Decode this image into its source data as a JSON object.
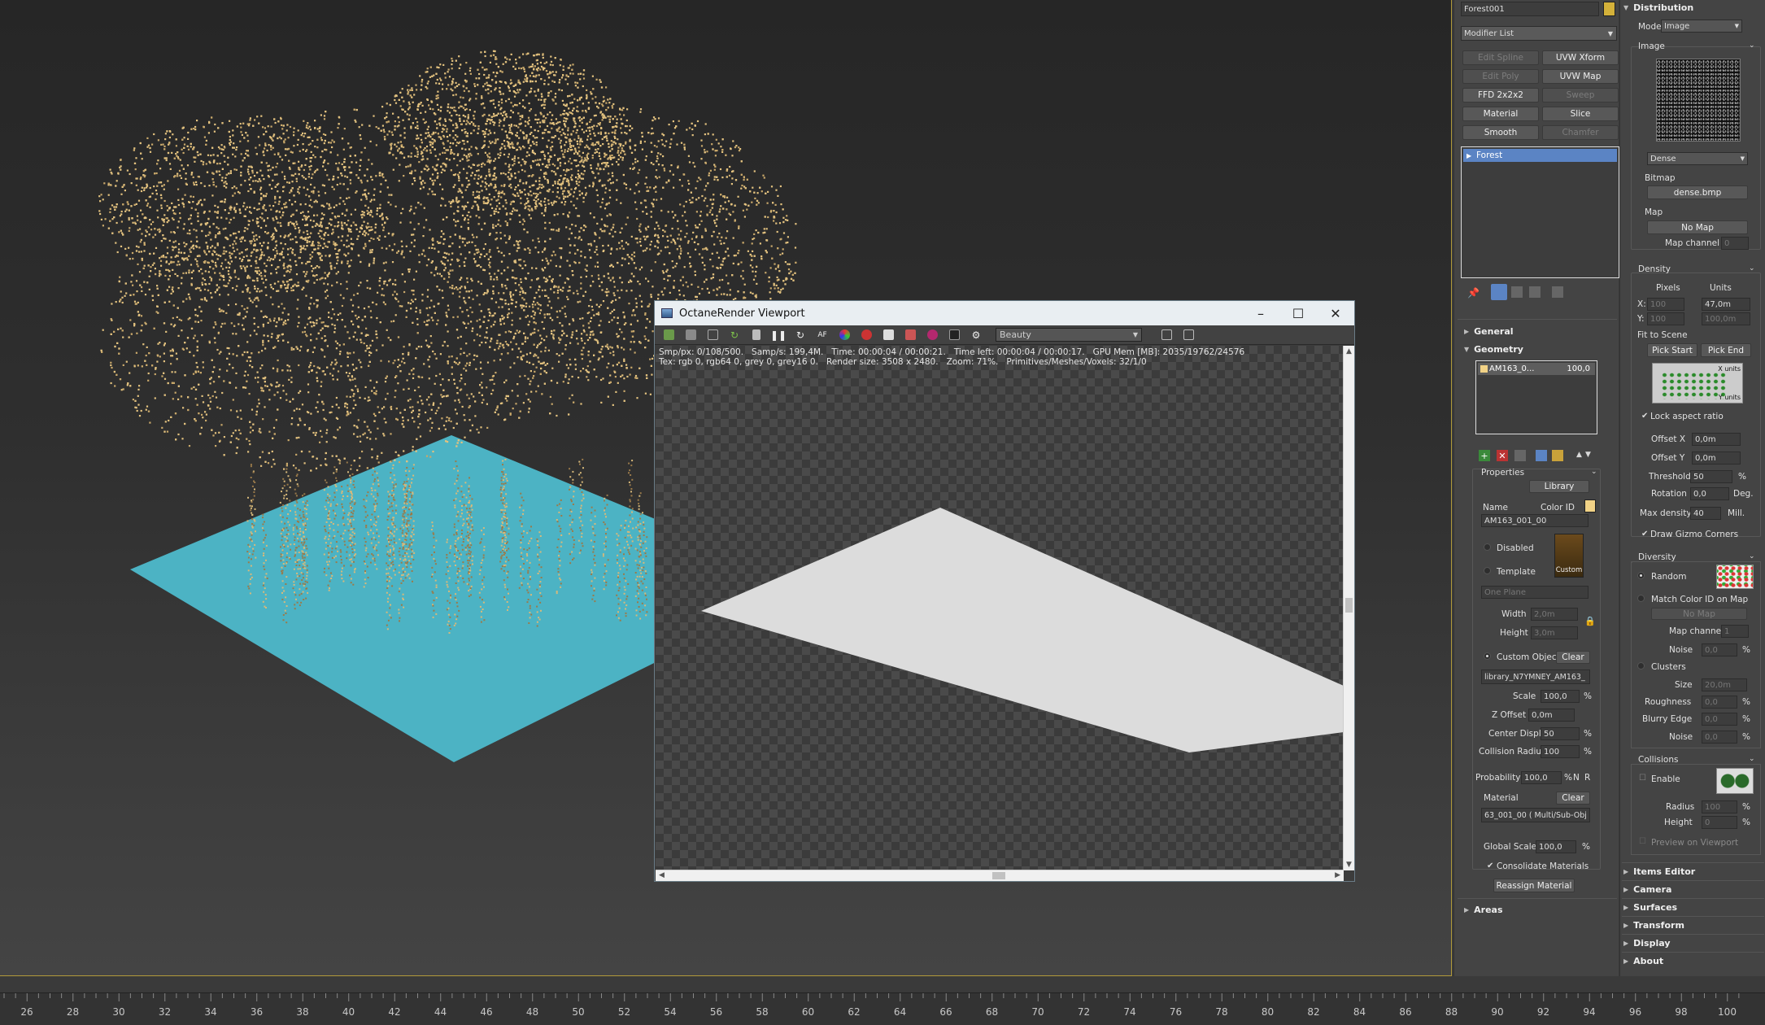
{
  "octane": {
    "title": "OctaneRender Viewport",
    "render_pass": "Beauty",
    "stats_line1": "Smp/px: 0/108/500.   Samp/s: 199,4M.   Time: 00:00:04 / 00:00:21.   Time left: 00:00:04 / 00:00:17.   GPU Mem [MB]: 2035/19762/24576",
    "stats_line2": "Tex: rgb 0, rgb64 0, grey 0, grey16 0.   Render size: 3508 x 2480.   Zoom: 71%.   Primitives/Meshes/Voxels: 32/1/0",
    "window_buttons": {
      "minimize": "–",
      "maximize": "☐",
      "close": "✕"
    }
  },
  "command_panel": {
    "object_name": "Forest001",
    "object_color": "#d4b13a",
    "modifier_list_label": "Modifier List",
    "modifier_buttons": [
      {
        "label": "Edit Spline",
        "enabled": false
      },
      {
        "label": "UVW Xform",
        "enabled": true
      },
      {
        "label": "Edit Poly",
        "enabled": false
      },
      {
        "label": "UVW Map",
        "enabled": true
      },
      {
        "label": "FFD 2x2x2",
        "enabled": true
      },
      {
        "label": "Sweep",
        "enabled": false
      },
      {
        "label": "Material",
        "enabled": true
      },
      {
        "label": "Slice",
        "enabled": true
      },
      {
        "label": "Smooth",
        "enabled": true
      },
      {
        "label": "Chamfer",
        "enabled": false
      }
    ],
    "stack_item": "Forest",
    "rollouts": {
      "general": "General",
      "geometry": "Geometry",
      "areas": "Areas"
    },
    "geometry": {
      "item_name": "AM163_0...",
      "item_value": "100,0",
      "properties_label": "Properties",
      "library_button": "Library",
      "name_label": "Name",
      "color_id_label": "Color ID",
      "name_value": "AM163_001_00",
      "disabled_label": "Disabled",
      "template_label": "Template",
      "custom_badge": "Custom",
      "one_plane": "One Plane",
      "width_label": "Width",
      "width_value": "2,0m",
      "height_label": "Height",
      "height_value": "3,0m",
      "custom_object_label": "Custom Object",
      "clear_label": "Clear",
      "custom_object_value": "library_N7YMNEY_AM163_",
      "scale_label": "Scale",
      "scale_value": "100,0",
      "zoffset_label": "Z Offset",
      "zoffset_value": "0,0m",
      "center_displ_label": "Center Displ.",
      "center_displ_value": "50",
      "collision_radius_label": "Collision Radius",
      "collision_radius_value": "100",
      "probability_label": "Probability",
      "probability_value": "100,0",
      "n_label": "N",
      "r_label": "R",
      "material_label": "Material",
      "material_clear": "Clear",
      "material_value": "63_001_00  ( Multi/Sub-Obj",
      "global_scale_label": "Global Scale",
      "global_scale_value": "100,0",
      "consolidate_label": "Consolidate Materials",
      "reassign_label": "Reassign Material",
      "percent": "%"
    }
  },
  "distribution_panel": {
    "title": "Distribution",
    "mode_label": "Mode",
    "mode_value": "Image",
    "image_label": "Image",
    "preset_value": "Dense",
    "bitmap_label": "Bitmap",
    "bitmap_value": "dense.bmp",
    "map_label": "Map",
    "map_value": "No Map",
    "map_channel_label": "Map channel",
    "map_channel_value": "0",
    "density_label": "Density",
    "pixels_label": "Pixels",
    "units_label": "Units",
    "x_label": "X:",
    "y_label": "Y:",
    "x_pixels": "100",
    "x_units": "47,0m",
    "y_pixels": "100",
    "y_units": "100,0m",
    "fit_to_scene": "Fit to Scene",
    "pick_start": "Pick Start",
    "pick_end": "Pick End",
    "x_units_tag": "X units",
    "y_units_tag": "Y units",
    "lock_aspect": "Lock aspect ratio",
    "offset_x_label": "Offset X",
    "offset_x_value": "0,0m",
    "offset_y_label": "Offset Y",
    "offset_y_value": "0,0m",
    "threshold_label": "Threshold",
    "threshold_value": "50",
    "rotation_label": "Rotation",
    "rotation_value": "0,0",
    "deg": "Deg.",
    "max_density_label": "Max density",
    "max_density_value": "40",
    "mill": "Mill.",
    "draw_gizmo": "Draw Gizmo Corners",
    "diversity_label": "Diversity",
    "random_label": "Random",
    "match_color_label": "Match Color ID on Map",
    "no_map": "No Map",
    "div_map_channel_label": "Map channel",
    "div_map_channel_value": "1",
    "noise_label": "Noise",
    "noise_value": "0,0",
    "clusters_label": "Clusters",
    "size_label": "Size",
    "size_value": "20,0m",
    "roughness_label": "Roughness",
    "roughness_value": "0,0",
    "blurry_label": "Blurry Edge",
    "blurry_value": "0,0",
    "noise2_label": "Noise",
    "noise2_value": "0,0",
    "collisions_label": "Collisions",
    "enable_label": "Enable",
    "radius_label": "Radius",
    "radius_value": "100",
    "height_label": "Height",
    "height_value": "0",
    "preview_label": "Preview on Viewport",
    "percent": "%",
    "bottom_rollouts": [
      "Items Editor",
      "Camera",
      "Surfaces",
      "Transform",
      "Display",
      "About"
    ]
  },
  "timeline": {
    "ticks": [
      "26",
      "28",
      "30",
      "32",
      "34",
      "36",
      "38",
      "40",
      "42",
      "44",
      "46",
      "48",
      "50",
      "52",
      "54",
      "56",
      "58",
      "60",
      "62",
      "64",
      "66",
      "68",
      "70",
      "72",
      "74",
      "76",
      "78",
      "80",
      "82",
      "84",
      "86",
      "88",
      "90",
      "92",
      "94",
      "96",
      "98",
      "100"
    ]
  }
}
